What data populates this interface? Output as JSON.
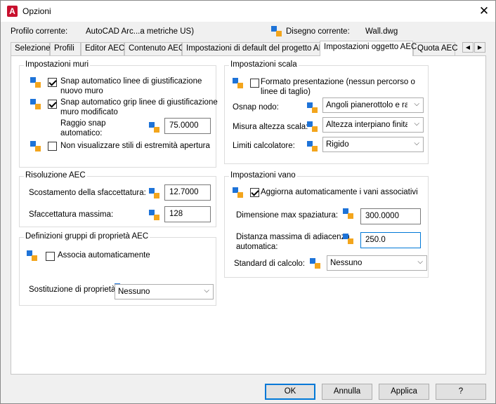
{
  "window": {
    "title": "Opzioni",
    "app_icon": "A",
    "close": "✕"
  },
  "profile": {
    "label": "Profilo corrente:",
    "value": "AutoCAD Arc...a metriche US)",
    "drawing_label": "Disegno corrente:",
    "drawing_value": "Wall.dwg"
  },
  "tabs": [
    "Selezione",
    "Profili",
    "Editor AEC",
    "Contenuto AEC",
    "Impostazioni di default del progetto AEC",
    "Impostazioni oggetto AEC",
    "Quota AEC"
  ],
  "active_tab": "Impostazioni oggetto AEC",
  "tab_arrows": {
    "left": "◀",
    "right": "▶"
  },
  "walls": {
    "title": "Impostazioni muri",
    "snap_lines": {
      "line1": "Snap automatico linee di giustificazione",
      "line2": "nuovo muro",
      "checked": true
    },
    "snap_grips": {
      "line1": "Snap automatico grip linee di giustificazione",
      "line2": "muro modificato",
      "checked": true
    },
    "radius_label1": "Raggio snap",
    "radius_label2": "automatico:",
    "radius_value": "75.0000",
    "no_endcap": {
      "label": "Non visualizzare stili di estremità apertura",
      "checked": false
    }
  },
  "facet": {
    "title": "Risoluzione AEC",
    "deviation_label": "Scostamento della sfaccettatura:",
    "deviation_value": "12.7000",
    "max_label": "Sfaccettatura massima:",
    "max_value": "128"
  },
  "propsets": {
    "title": "Definizioni gruppi di proprietà AEC",
    "auto_label": "Associa automaticamente",
    "auto_checked": false,
    "override_label": "Sostituzione di proprietà",
    "override_value": "Nessuno"
  },
  "stairs": {
    "title": "Impostazioni scala",
    "present_line1": "Formato presentazione (nessun percorso o",
    "present_line2": "linee di taglio)",
    "present_checked": false,
    "osnap_label": "Osnap nodo:",
    "osnap_value": "Angoli pianerottolo e ram",
    "height_label": "Misura altezza scala:",
    "height_value": "Altezza interpiano finita",
    "limits_label": "Limiti calcolatore:",
    "limits_value": "Rigido"
  },
  "spaces": {
    "title": "Impostazioni vano",
    "update_label": "Aggiorna automaticamente i vani associativi",
    "update_checked": true,
    "gap_label": "Dimensione max spaziatura:",
    "gap_value": "300.0000",
    "adj_label1": "Distanza massima di adiacenza",
    "adj_label2": "automatica:",
    "adj_value": "250.0",
    "std_label": "Standard di calcolo:",
    "std_value": "Nessuno"
  },
  "buttons": {
    "ok": "OK",
    "cancel": "Annulla",
    "apply": "Applica",
    "help": "?"
  },
  "colors": {
    "accent": "#0078d7",
    "icon_blue": "#1e73d8",
    "icon_orange": "#f3a51c",
    "app_red": "#c8102e"
  }
}
